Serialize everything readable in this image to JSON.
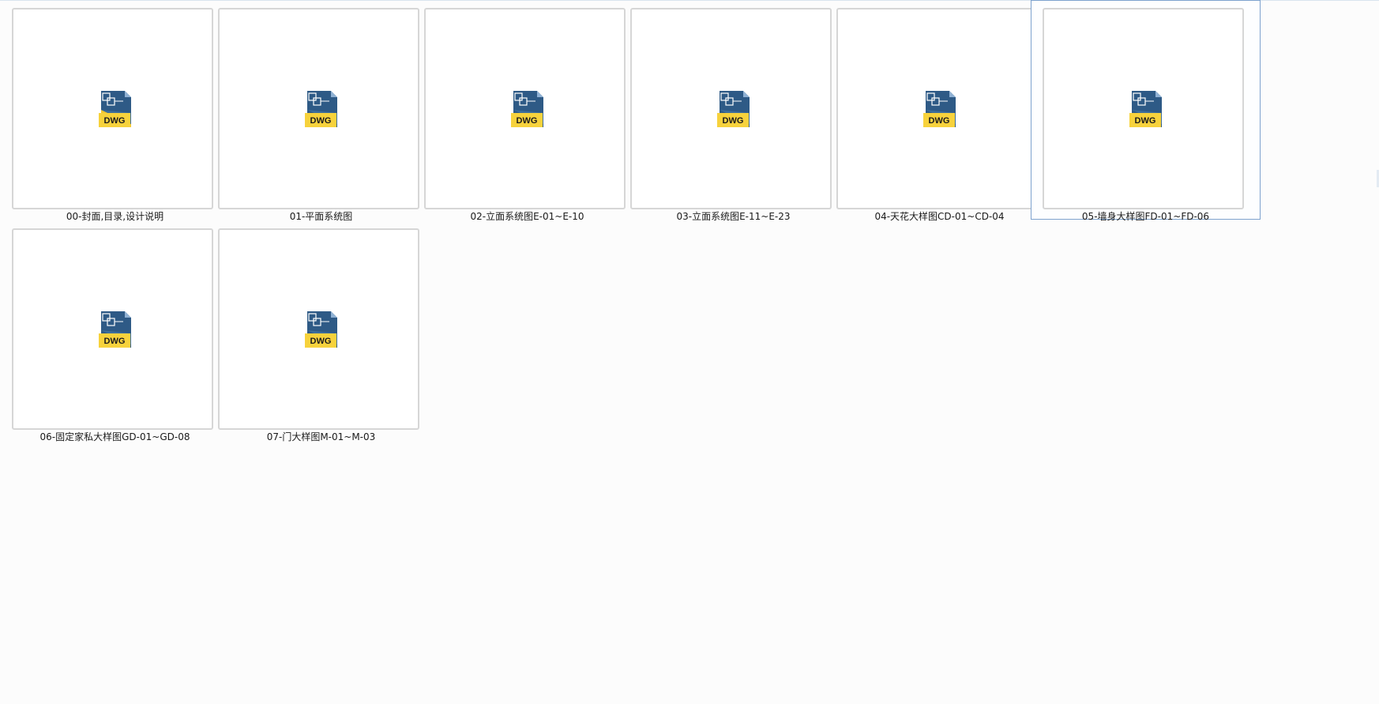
{
  "files": [
    {
      "name": "00-封面,目录,设计说明",
      "badge": "DWG",
      "selected": false
    },
    {
      "name": "01-平面系统图",
      "badge": "DWG",
      "selected": false
    },
    {
      "name": "02-立面系统图E-01~E-10",
      "badge": "DWG",
      "selected": false
    },
    {
      "name": "03-立面系统图E-11~E-23",
      "badge": "DWG",
      "selected": false
    },
    {
      "name": "04-天花大样图CD-01~CD-04",
      "badge": "DWG",
      "selected": false
    },
    {
      "name": "05-墙身大样图FD-01~FD-06",
      "badge": "DWG",
      "selected": true
    },
    {
      "name": "06-固定家私大样图GD-01~GD-08",
      "badge": "DWG",
      "selected": false
    },
    {
      "name": "07-门大样图M-01~M-03",
      "badge": "DWG",
      "selected": false
    }
  ],
  "colors": {
    "selection_border": "#7da2ce",
    "icon_blue": "#2e5a86",
    "icon_yellow": "#f5c830"
  },
  "icons": {
    "file_icon": "dwg-file-icon"
  }
}
